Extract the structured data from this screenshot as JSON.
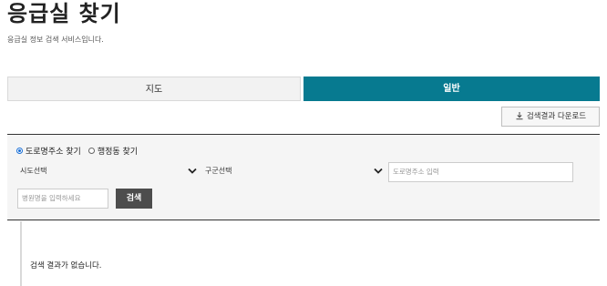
{
  "header": {
    "title": "응급실 찾기",
    "subtitle": "응급실 정보 검색 서비스입니다."
  },
  "tabs": [
    {
      "label": "지도",
      "active": false
    },
    {
      "label": "일반",
      "active": true
    }
  ],
  "toolbar": {
    "download_label": "검색결과 다운로드",
    "download_icon": "download-icon"
  },
  "search": {
    "radio_options": [
      {
        "label": "도로명주소 찾기",
        "selected": true
      },
      {
        "label": "행정동 찾기",
        "selected": false
      }
    ],
    "sido_select": "시도선택",
    "gugun_select": "구군선택",
    "road_placeholder": "도로명주소 입력",
    "hospital_placeholder": "병원명을 입력하세요",
    "search_button": "검색"
  },
  "results": {
    "empty_message": "검색 결과가 없습니다."
  },
  "colors": {
    "accent": "#077a90",
    "button_dark": "#4d4d4d",
    "radio_selected": "#1a6fd6"
  }
}
